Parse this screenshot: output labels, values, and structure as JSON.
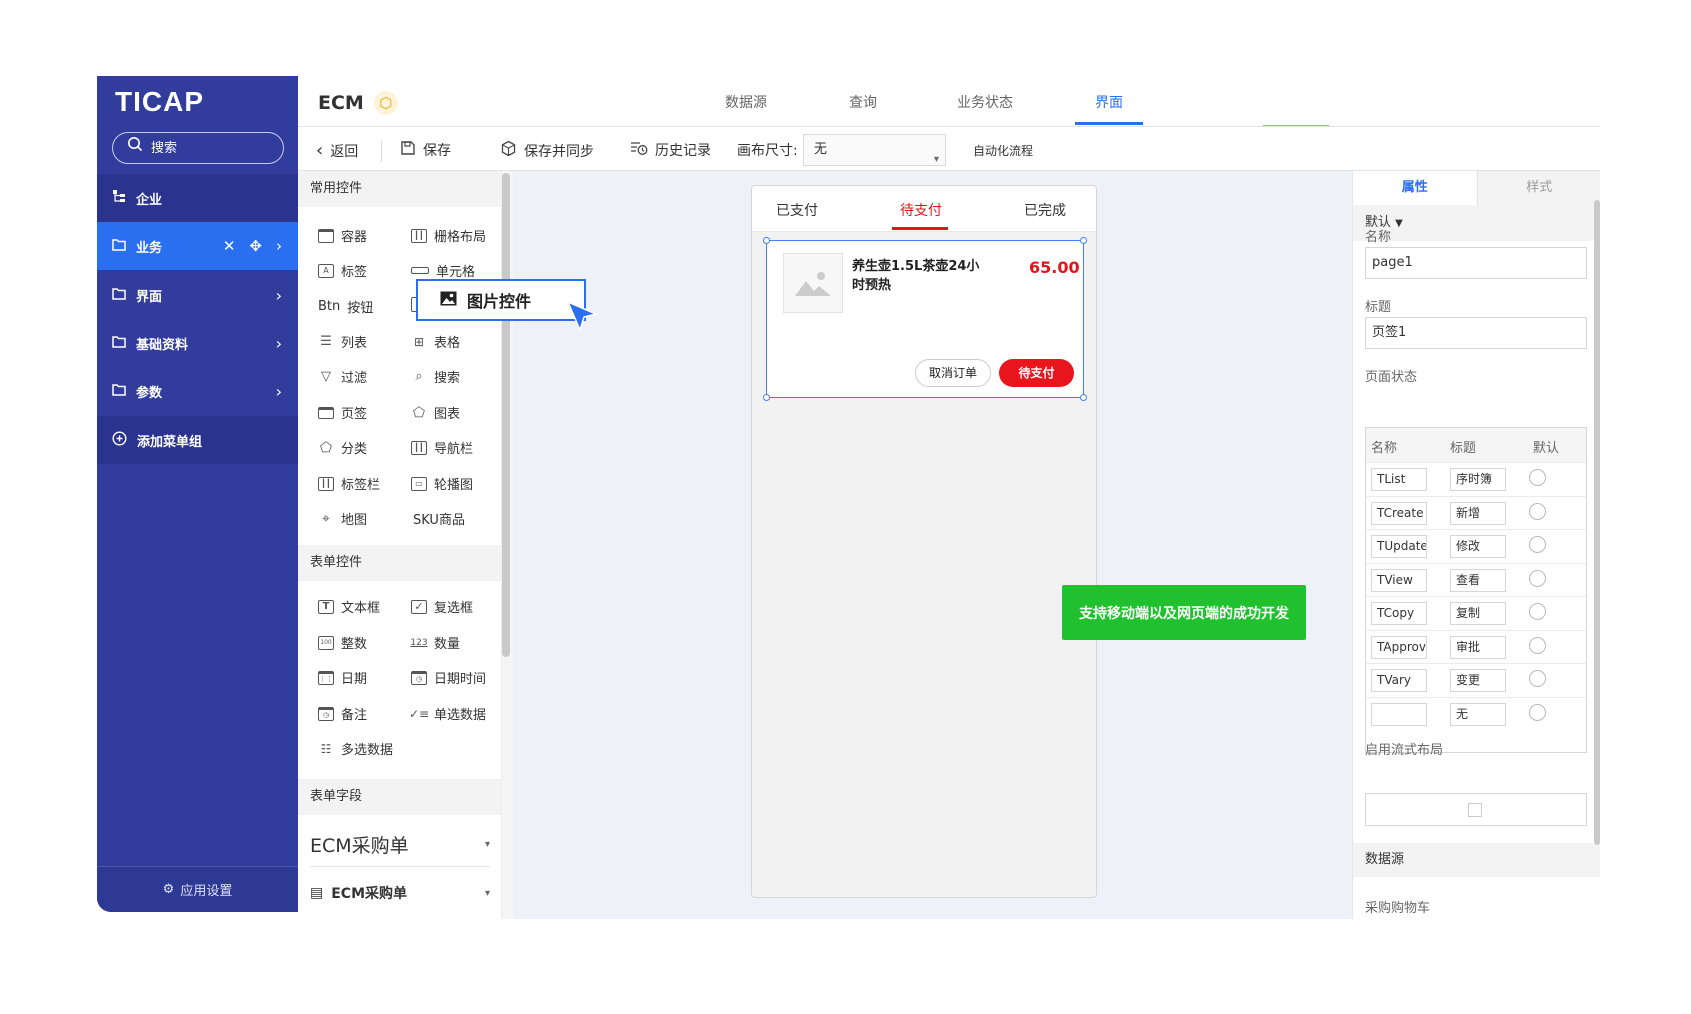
{
  "app": {
    "logo": "TICAP",
    "title": "ECM"
  },
  "sidebar": {
    "search_label": "搜索",
    "items": [
      {
        "label": "企业"
      },
      {
        "label": "业务"
      },
      {
        "label": "界面"
      },
      {
        "label": "基础资料"
      },
      {
        "label": "参数"
      }
    ],
    "add_group": "添加菜单组",
    "settings": "应用设置"
  },
  "header": {
    "tabs": [
      {
        "label": "数据源"
      },
      {
        "label": "查询"
      },
      {
        "label": "业务状态"
      },
      {
        "label": "界面"
      }
    ]
  },
  "toolbar": {
    "back": "返回",
    "save": "保存",
    "save_sync": "保存并同步",
    "history": "历史记录",
    "canvas_size_label": "画布尺寸:",
    "canvas_size_value": "无",
    "automation": "自动化流程"
  },
  "components": {
    "common_title": "常用控件",
    "common": [
      {
        "label": "容器"
      },
      {
        "label": "栅格布局"
      },
      {
        "label": "标签"
      },
      {
        "label": "单元格"
      },
      {
        "label": "按钮",
        "prefix": "Btn"
      },
      {
        "label": "列表"
      },
      {
        "label": "表格"
      },
      {
        "label": "过滤"
      },
      {
        "label": "搜索"
      },
      {
        "label": "页签"
      },
      {
        "label": "图表"
      },
      {
        "label": "分类"
      },
      {
        "label": "导航栏"
      },
      {
        "label": "标签栏"
      },
      {
        "label": "轮播图"
      },
      {
        "label": "地图"
      },
      {
        "label": "SKU商品"
      }
    ],
    "form_title": "表单控件",
    "form": [
      {
        "label": "文本框"
      },
      {
        "label": "复选框"
      },
      {
        "label": "整数"
      },
      {
        "label": "数量"
      },
      {
        "label": "日期"
      },
      {
        "label": "日期时间"
      },
      {
        "label": "备注"
      },
      {
        "label": "单选数据"
      },
      {
        "label": "多选数据"
      }
    ],
    "fields_title": "表单字段",
    "field_select": "ECM采购单",
    "field_item": "ECM采购单",
    "dragging": "图片控件"
  },
  "phone": {
    "tabs": [
      {
        "label": "已支付"
      },
      {
        "label": "待支付"
      },
      {
        "label": "已完成"
      }
    ],
    "order": {
      "name": "养生壶1.5L茶壶24小时预热",
      "price": "65.00",
      "cancel": "取消订单",
      "pay": "待支付"
    }
  },
  "note": "支持移动端以及网页端的成功开发",
  "props": {
    "tabs": [
      {
        "label": "属性"
      },
      {
        "label": "样式"
      }
    ],
    "default_label": "默认",
    "name_label": "名称",
    "name_value": "page1",
    "title_label": "标题",
    "title_value": "页签1",
    "state_label": "页面状态",
    "state_headers": [
      "名称",
      "标题",
      "默认"
    ],
    "states": [
      {
        "name": "TList",
        "title": "序时簿"
      },
      {
        "name": "TCreate",
        "title": "新增"
      },
      {
        "name": "TUpdate",
        "title": "修改"
      },
      {
        "name": "TView",
        "title": "查看"
      },
      {
        "name": "TCopy",
        "title": "复制"
      },
      {
        "name": "TApprove",
        "title": "审批"
      },
      {
        "name": "TVary",
        "title": "变更"
      },
      {
        "name": "",
        "title": "无"
      }
    ],
    "flow_label": "启用流式布局",
    "datasource_label": "数据源",
    "datasource_value": "采购购物车"
  },
  "colors": {
    "sidebar": "#313c9d",
    "accent": "#2a6ff0",
    "danger": "#e0161e",
    "note": "#20c02f"
  }
}
